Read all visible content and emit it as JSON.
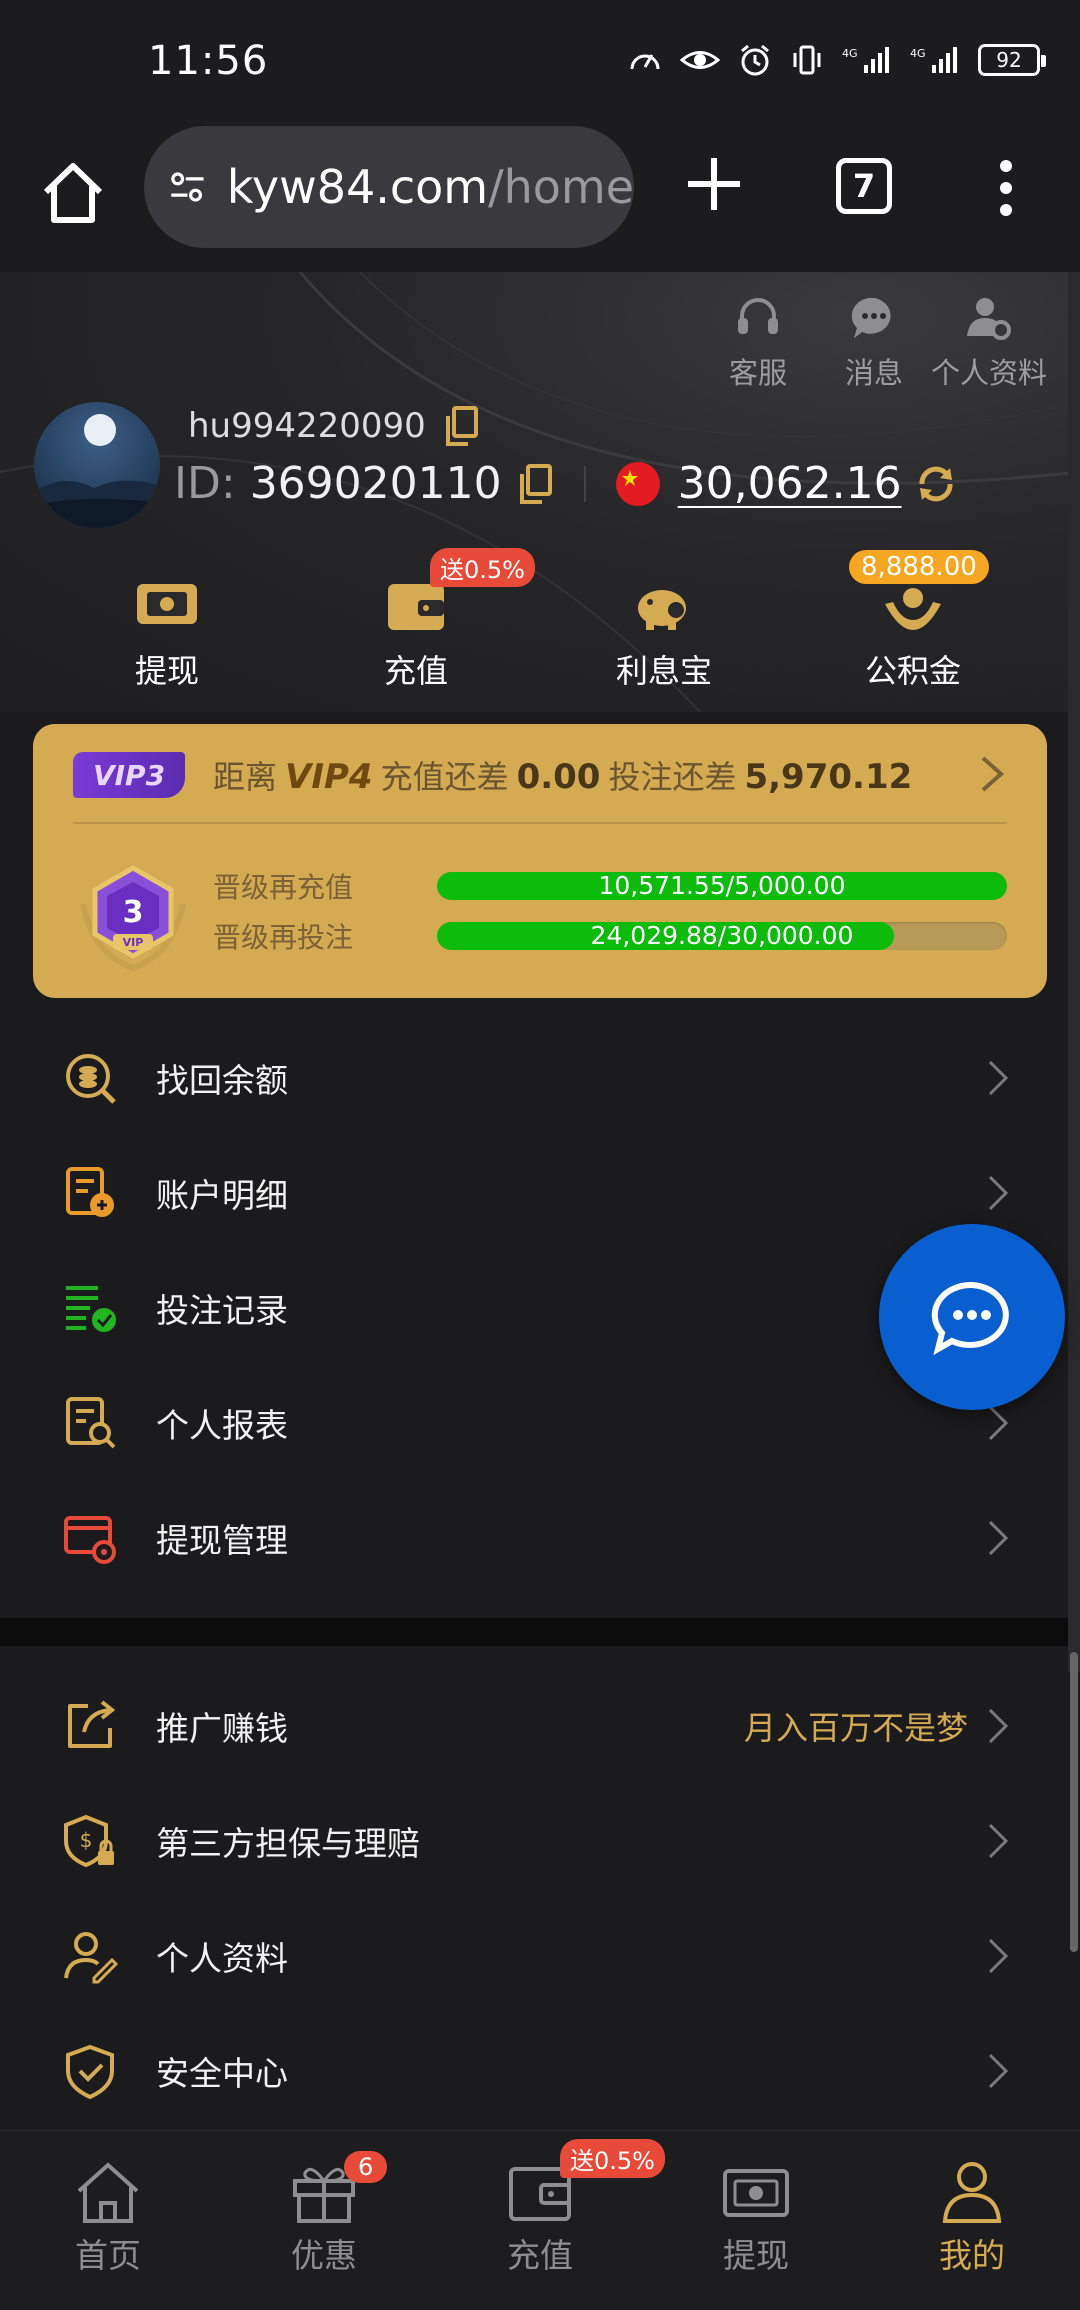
{
  "status_bar": {
    "time": "11:56",
    "battery": "92",
    "signal1": "4G",
    "signal2": "4G"
  },
  "browser": {
    "url_domain": "kyw84.com",
    "url_path": "/home",
    "tab_count": "7"
  },
  "header": {
    "top_icons": [
      {
        "label": "客服",
        "icon": "headset-icon"
      },
      {
        "label": "消息",
        "icon": "message-icon"
      },
      {
        "label": "个人资料",
        "icon": "profile-settings-icon"
      }
    ],
    "username": "hu994220090",
    "id_label": "ID:",
    "id_value": "369020110",
    "balance": "30,062.16",
    "quick_actions": [
      {
        "label": "提现",
        "icon": "withdraw-icon"
      },
      {
        "label": "充值",
        "icon": "deposit-wallet-icon",
        "badge": "送0.5%"
      },
      {
        "label": "利息宝",
        "icon": "piggy-bank-icon"
      },
      {
        "label": "公积金",
        "icon": "fund-hands-icon",
        "badge": "8,888.00"
      }
    ]
  },
  "vip": {
    "current": "VIP3",
    "medal_level": "3",
    "medal_text": "VIP",
    "line_prefix": "距离",
    "next_level": "VIP4",
    "deposit_gap_label": "充值还差",
    "deposit_gap": "0.00",
    "bet_gap_label": "投注还差",
    "bet_gap": "5,970.12",
    "progress": [
      {
        "label": "晋级再充值",
        "text": "10,571.55/5,000.00",
        "fraction": 1.0
      },
      {
        "label": "晋级再投注",
        "text": "24,029.88/30,000.00",
        "fraction": 0.801
      }
    ]
  },
  "menu1": [
    {
      "label": "找回余额",
      "icon": "recover-balance-icon"
    },
    {
      "label": "账户明细",
      "icon": "account-details-icon"
    },
    {
      "label": "投注记录",
      "icon": "bet-record-icon"
    },
    {
      "label": "个人报表",
      "icon": "personal-report-icon"
    },
    {
      "label": "提现管理",
      "icon": "withdraw-manage-icon"
    }
  ],
  "menu2": [
    {
      "label": "推广赚钱",
      "icon": "share-earn-icon",
      "hint": "月入百万不是梦"
    },
    {
      "label": "第三方担保与理赔",
      "icon": "guarantee-shield-icon"
    },
    {
      "label": "个人资料",
      "icon": "user-edit-icon"
    },
    {
      "label": "安全中心",
      "icon": "security-shield-icon"
    }
  ],
  "bottom_nav": [
    {
      "label": "首页",
      "icon": "home-icon"
    },
    {
      "label": "优惠",
      "icon": "gift-icon",
      "badge": "6"
    },
    {
      "label": "充值",
      "icon": "wallet-icon",
      "badge": "送0.5%"
    },
    {
      "label": "提现",
      "icon": "cash-icon"
    },
    {
      "label": "我的",
      "icon": "user-icon",
      "active": true
    }
  ],
  "colors": {
    "gold": "#d4ab52",
    "progress_green": "#0dbb0d",
    "badge_red": "#e84a3a",
    "fab_blue": "#0a5fd0"
  }
}
